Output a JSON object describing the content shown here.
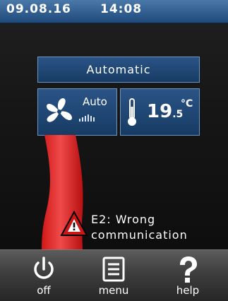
{
  "status_bar": {
    "date": "09.08.16",
    "time": "14:08"
  },
  "mode": {
    "label": "Automatic"
  },
  "fan": {
    "label": "Auto",
    "icon": "fan-icon",
    "level_bars": 6
  },
  "temperature": {
    "integer": "19",
    "decimal": ".5",
    "unit": "°C",
    "icon": "thermometer-icon"
  },
  "alert": {
    "line1": "E2: Wrong",
    "line2": "communication",
    "icon": "warning-icon"
  },
  "nav": {
    "off_label": "off",
    "menu_label": "menu",
    "help_label": "help"
  },
  "colors": {
    "status_bar": "#2f5f94",
    "tile": "#1f4674",
    "alert_red": "#e02020",
    "bottom_bar": "#3e3e3e"
  }
}
